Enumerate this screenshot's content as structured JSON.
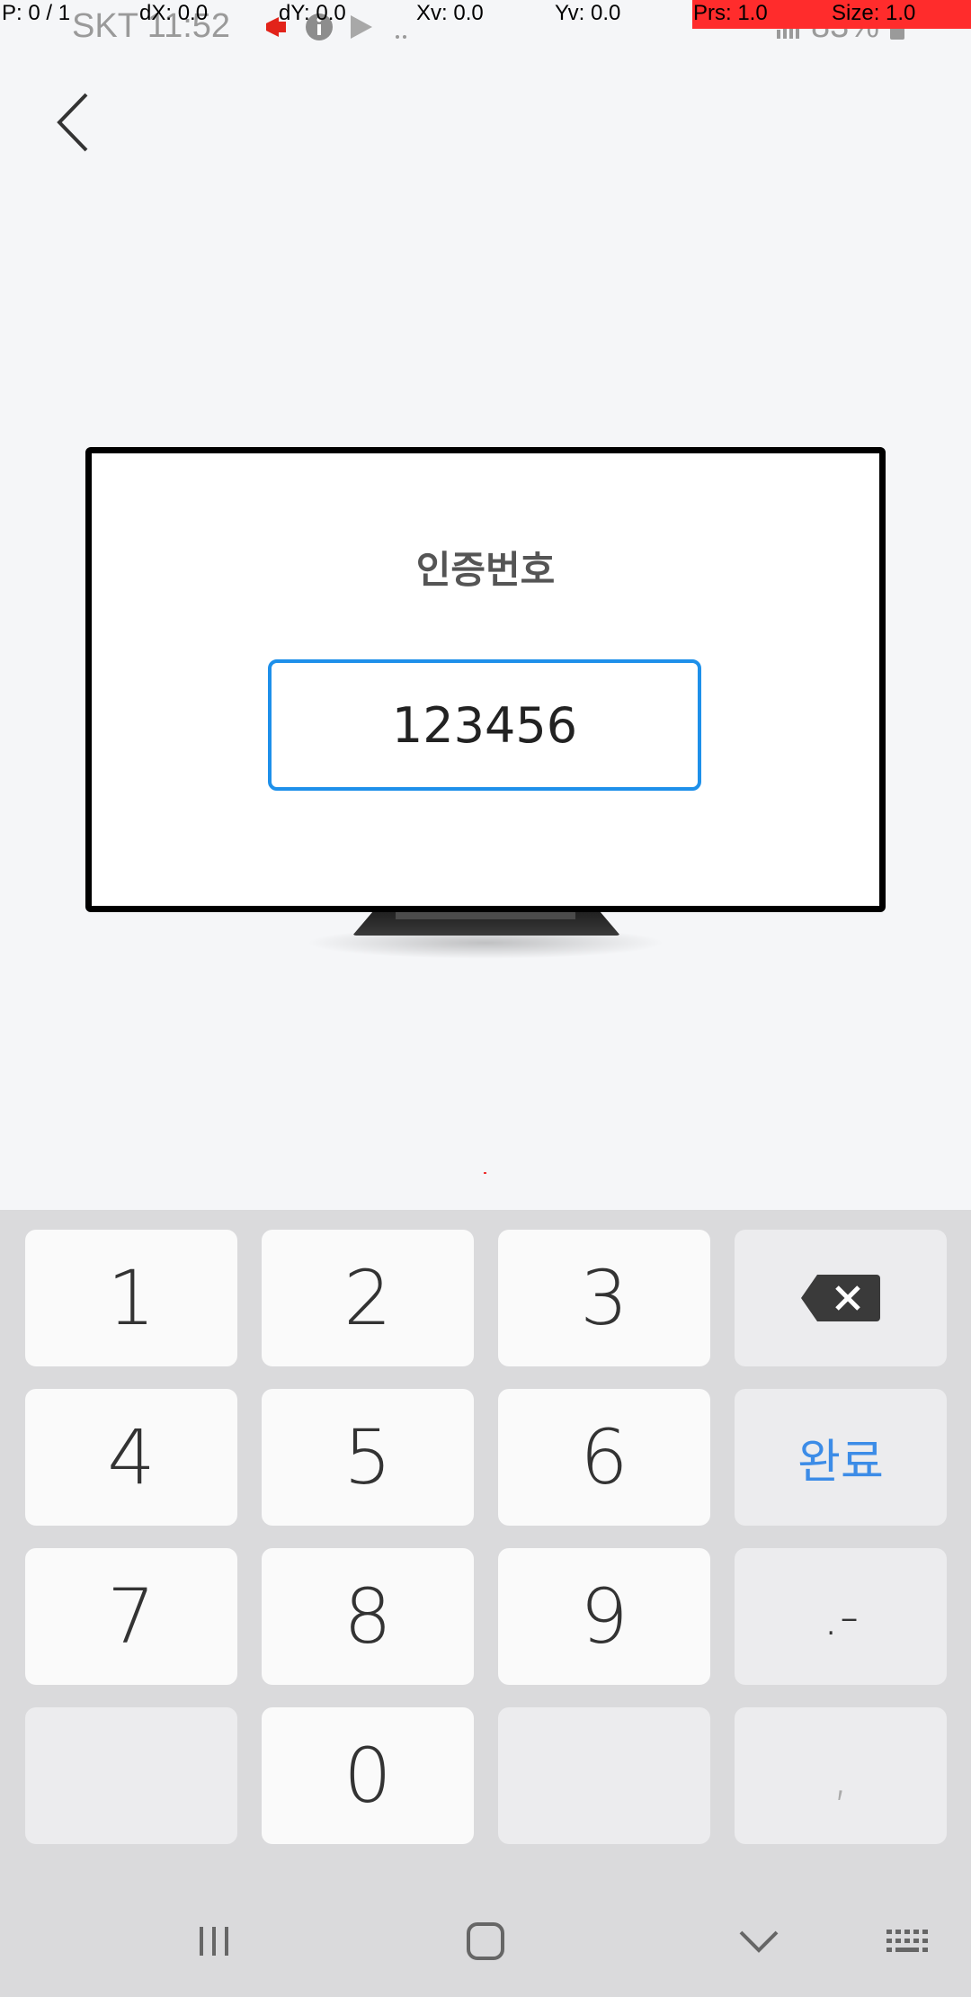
{
  "status_bar": {
    "carrier_time": "SKT 11:52",
    "battery": "83%"
  },
  "pointer_overlay": {
    "p": "P: 0 / 1",
    "dx": "dX: 0.0",
    "dy": "dY: 0.0",
    "xv": "Xv: 0.0",
    "yv": "Yv: 0.0",
    "prs": "Prs: 1.0",
    "size": "Size: 1.0"
  },
  "screen": {
    "code_label": "인증번호",
    "code_value": "123456"
  },
  "keypad": {
    "keys": [
      {
        "label": "1"
      },
      {
        "label": "2"
      },
      {
        "label": "3"
      },
      {
        "label": "backspace-icon"
      },
      {
        "label": "4"
      },
      {
        "label": "5"
      },
      {
        "label": "6"
      },
      {
        "label": "완료"
      },
      {
        "label": "7"
      },
      {
        "label": "8"
      },
      {
        "label": "9"
      },
      {
        "label": ".-"
      },
      {
        "label": ""
      },
      {
        "label": "0"
      },
      {
        "label": ""
      },
      {
        "label": ","
      }
    ]
  },
  "colors": {
    "accent": "#1e90ea",
    "done_text": "#3c8ce7",
    "overlay_red": "#ff2c2c"
  }
}
